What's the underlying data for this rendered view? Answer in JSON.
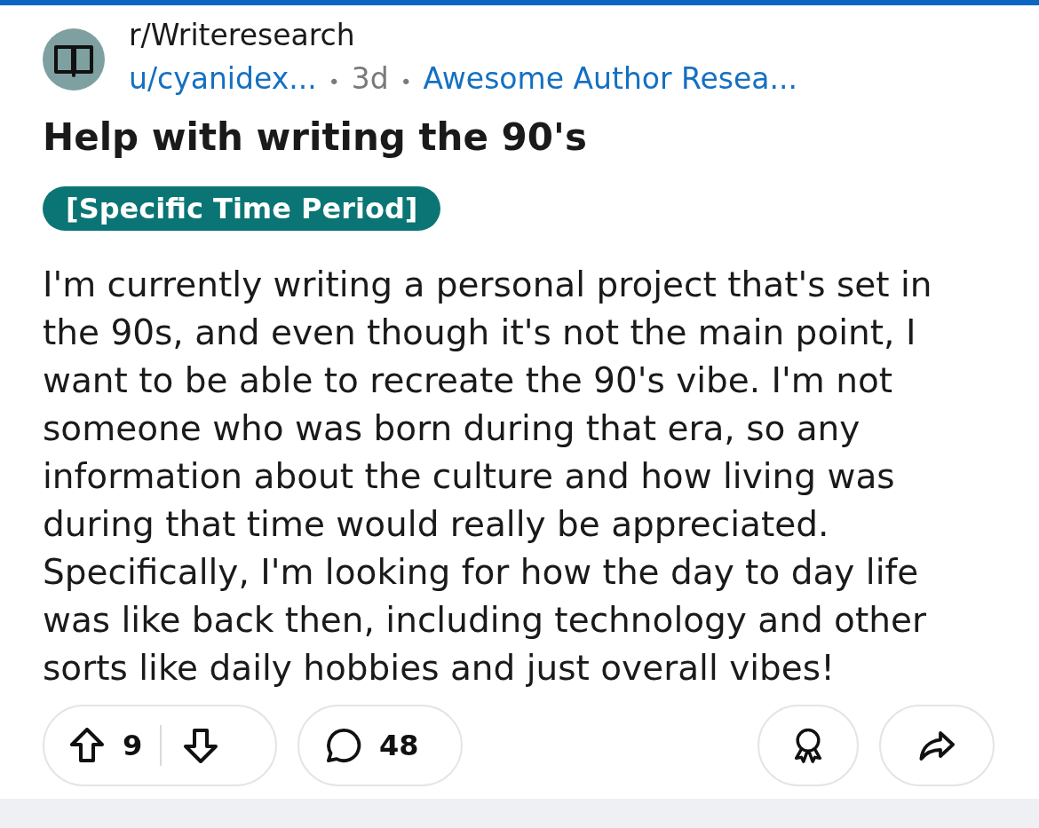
{
  "header": {
    "subreddit": "r/Writeresearch",
    "author": "u/cyanidex...",
    "separator_1": "•",
    "age": "3d",
    "separator_2": "•",
    "author_flair": "Awesome Author Resea..."
  },
  "post": {
    "title": "Help with writing the 90's",
    "flair": "[Specific Time Period]",
    "body": "I'm currently writing a personal project that's set in the 90s, and even though it's not the main point, I want to be able to recreate the 90's vibe. I'm not someone who was born during that era, so any information about the culture and how living was during that time would really be appreciated. Specifically, I'm looking for how the day to day life was like back then, including technology and other sorts like daily hobbies and just overall vibes!"
  },
  "actions": {
    "votes": "9",
    "comments": "48"
  }
}
